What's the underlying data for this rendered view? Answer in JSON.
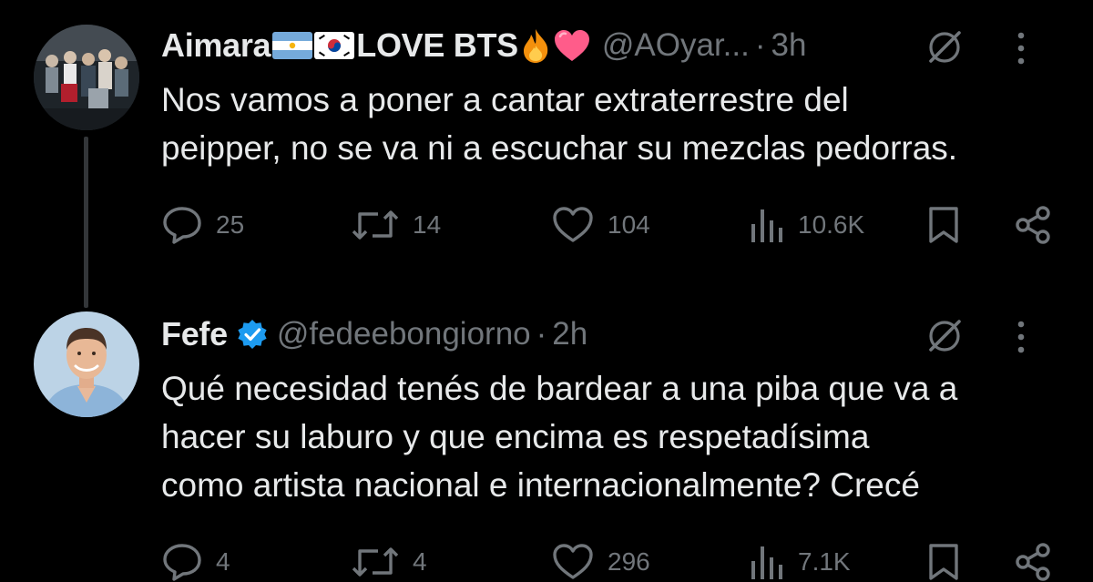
{
  "tweets": [
    {
      "display_name": "Aimara",
      "name_suffix": "LOVE BTS",
      "name_emojis": [
        "argentina-flag",
        "south-korea-flag",
        "fire-emoji",
        "pink-heart-emoji"
      ],
      "handle": "@AOyar...",
      "separator": "·",
      "time": "3h",
      "text": "Nos vamos a poner a cantar extraterrestre del\npeipper, no se va ni a escuchar su mezclas pedorras.",
      "stats": {
        "replies": "25",
        "retweets": "14",
        "likes": "104",
        "views": "10.6K"
      }
    },
    {
      "display_name": "Fefe",
      "verified": true,
      "handle": "@fedeebongiorno",
      "separator": "·",
      "time": "2h",
      "text": "Qué necesidad tenés de bardear a una piba que va a\nhacer su laburo y que encima es respetadísima\ncomo artista nacional e internacionalmente? Crecé",
      "stats": {
        "replies": "4",
        "retweets": "4",
        "likes": "296",
        "views": "7.1K"
      }
    }
  ],
  "icons": {
    "reply": "reply-icon",
    "retweet": "retweet-icon",
    "like": "heart-icon",
    "views": "views-icon",
    "bookmark": "bookmark-icon",
    "share": "share-icon",
    "grok": "grok-icon",
    "more": "more-icon",
    "verified": "verified-badge-icon"
  },
  "colors": {
    "background": "#000000",
    "text": "#e7e9ea",
    "secondary": "#71767b",
    "verified": "#1d9bf0",
    "thread_line": "#333639"
  }
}
